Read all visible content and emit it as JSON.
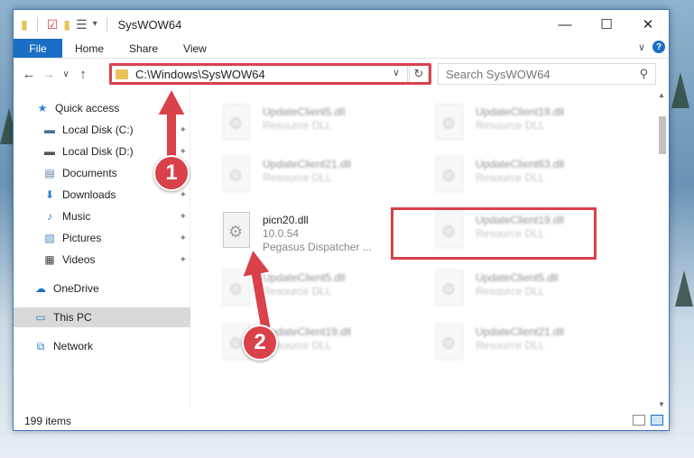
{
  "window": {
    "title": "SysWOW64",
    "controls": {
      "minimize": "—",
      "maximize": "☐",
      "close": "✕"
    }
  },
  "ribbon": {
    "tabs": [
      "File",
      "Home",
      "Share",
      "View"
    ],
    "expand_glyph": "∨",
    "help_glyph": "?"
  },
  "nav": {
    "back": "←",
    "forward": "→",
    "recent": "∨",
    "up": "↑",
    "address": "C:\\Windows\\SysWOW64",
    "search_placeholder": "Search SysWOW64"
  },
  "sidebar": {
    "items": [
      {
        "label": "Quick access",
        "icon": "star-icon",
        "glyph": "★",
        "color": "#2f7fd0",
        "pinned": false
      },
      {
        "label": "Local Disk (C:)",
        "icon": "drive-icon",
        "glyph": "▬",
        "color": "#4a6f91",
        "pinned": true
      },
      {
        "label": "Local Disk (D:)",
        "icon": "drive-icon",
        "glyph": "▬",
        "color": "#555555",
        "pinned": true
      },
      {
        "label": "Documents",
        "icon": "document-icon",
        "glyph": "▤",
        "color": "#5a7da6",
        "pinned": true
      },
      {
        "label": "Downloads",
        "icon": "download-icon",
        "glyph": "⬇",
        "color": "#2f7fd0",
        "pinned": true
      },
      {
        "label": "Music",
        "icon": "music-icon",
        "glyph": "♪",
        "color": "#2f7fd0",
        "pinned": true
      },
      {
        "label": "Pictures",
        "icon": "pictures-icon",
        "glyph": "▧",
        "color": "#4a87c2",
        "pinned": true
      },
      {
        "label": "Videos",
        "icon": "video-icon",
        "glyph": "▦",
        "color": "#444444",
        "pinned": true
      },
      {
        "label": "OneDrive",
        "icon": "cloud-icon",
        "glyph": "☁",
        "color": "#1a6fc4",
        "pinned": false
      },
      {
        "label": "This PC",
        "icon": "computer-icon",
        "glyph": "▭",
        "color": "#2f7fd0",
        "pinned": false
      },
      {
        "label": "Network",
        "icon": "network-icon",
        "glyph": "⧉",
        "color": "#2f7fd0",
        "pinned": false
      }
    ]
  },
  "files": [
    {
      "name": "UpdateClient5.dll",
      "sub": "Resource DLL",
      "faded": true
    },
    {
      "name": "UpdateClient19.dll",
      "sub": "Resource DLL",
      "faded": true
    },
    {
      "name": "UpdateClient21.dll",
      "sub": "Resource DLL",
      "faded": true
    },
    {
      "name": "UpdateClient63.dll",
      "sub": "Resource DLL",
      "faded": true
    },
    {
      "name": "picn20.dll",
      "sub": "10.0.54",
      "sub2": "Pegasus Dispatcher ...",
      "faded": false
    },
    {
      "name": "UpdateClient19.dll",
      "sub": "Resource DLL",
      "faded": true
    },
    {
      "name": "UpdateClient5.dll",
      "sub": "Resource DLL",
      "faded": true
    },
    {
      "name": "UpdateClient5.dll",
      "sub": "Resource DLL",
      "faded": true
    },
    {
      "name": "UpdateClient19.dll",
      "sub": "Resource DLL",
      "faded": true
    },
    {
      "name": "UpdateClient21.dll",
      "sub": "Resource DLL",
      "faded": true
    }
  ],
  "status": {
    "item_count": "199 items"
  },
  "annotations": {
    "step1": "1",
    "step2": "2",
    "color": "#d9414b"
  }
}
